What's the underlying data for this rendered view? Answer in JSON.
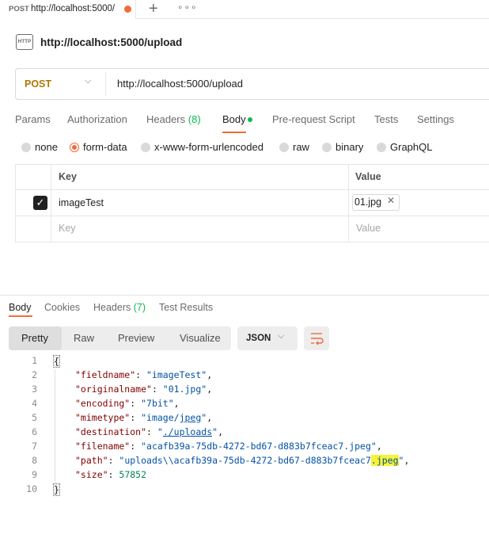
{
  "tab": {
    "method": "POST",
    "url": "http://localhost:5000/",
    "new_tab_icon": "plus-icon",
    "more_icon": "more-icon"
  },
  "title": {
    "icon_label": "HTTP",
    "text": "http://localhost:5000/upload"
  },
  "request": {
    "method": "POST",
    "url": "http://localhost:5000/upload"
  },
  "request_tabs": {
    "params": "Params",
    "authorization": "Authorization",
    "headers_label": "Headers",
    "headers_count": "(8)",
    "body": "Body",
    "prerequest": "Pre-request Script",
    "tests": "Tests",
    "settings": "Settings"
  },
  "body_types": [
    "none",
    "form-data",
    "x-www-form-urlencoded",
    "raw",
    "binary",
    "GraphQL"
  ],
  "body_type_selected": "form-data",
  "form_table": {
    "col_key": "Key",
    "col_value": "Value",
    "row_key": "imageTest",
    "row_file": "01.jpg",
    "row_checked": true,
    "placeholder_key": "Key",
    "placeholder_value": "Value"
  },
  "response_tabs": {
    "body": "Body",
    "cookies": "Cookies",
    "headers_label": "Headers",
    "headers_count": "(7)",
    "test_results": "Test Results"
  },
  "view_modes": [
    "Pretty",
    "Raw",
    "Preview",
    "Visualize"
  ],
  "view_mode_selected": "Pretty",
  "format": "JSON",
  "response_json": {
    "line_numbers": [
      "1",
      "2",
      "3",
      "4",
      "5",
      "6",
      "7",
      "8",
      "9",
      "10"
    ],
    "open_brace": "{",
    "close_brace": "}",
    "fieldname": {
      "key": "\"fieldname\"",
      "value": "\"imageTest\""
    },
    "originalname": {
      "key": "\"originalname\"",
      "value": "\"01.jpg\""
    },
    "encoding": {
      "key": "\"encoding\"",
      "value": "\"7bit\""
    },
    "mimetype": {
      "key": "\"mimetype\"",
      "value_a": "\"image/",
      "value_b": "jpeg",
      "value_c": "\""
    },
    "destination": {
      "key": "\"destination\"",
      "value_a": "\"",
      "value_b": "./uploads",
      "value_c": "\""
    },
    "filename": {
      "key": "\"filename\"",
      "value": "\"acafb39a-75db-4272-bd67-d883b7fceac7.jpeg\""
    },
    "path": {
      "key": "\"path\"",
      "value_a": "\"uploads\\\\acafb39a-75db-4272-bd67-d883b7fceac7",
      "value_b": ".jpeg",
      "value_c": "\""
    },
    "size": {
      "key": "\"size\"",
      "value": "57852"
    }
  },
  "colors": {
    "accent": "#f26b3a",
    "method_post": "#ad7a03",
    "success_count": "#0cbb52",
    "json_key": "#800000",
    "json_string": "#0451a5",
    "json_number": "#098658",
    "highlight": "#f6f336"
  }
}
